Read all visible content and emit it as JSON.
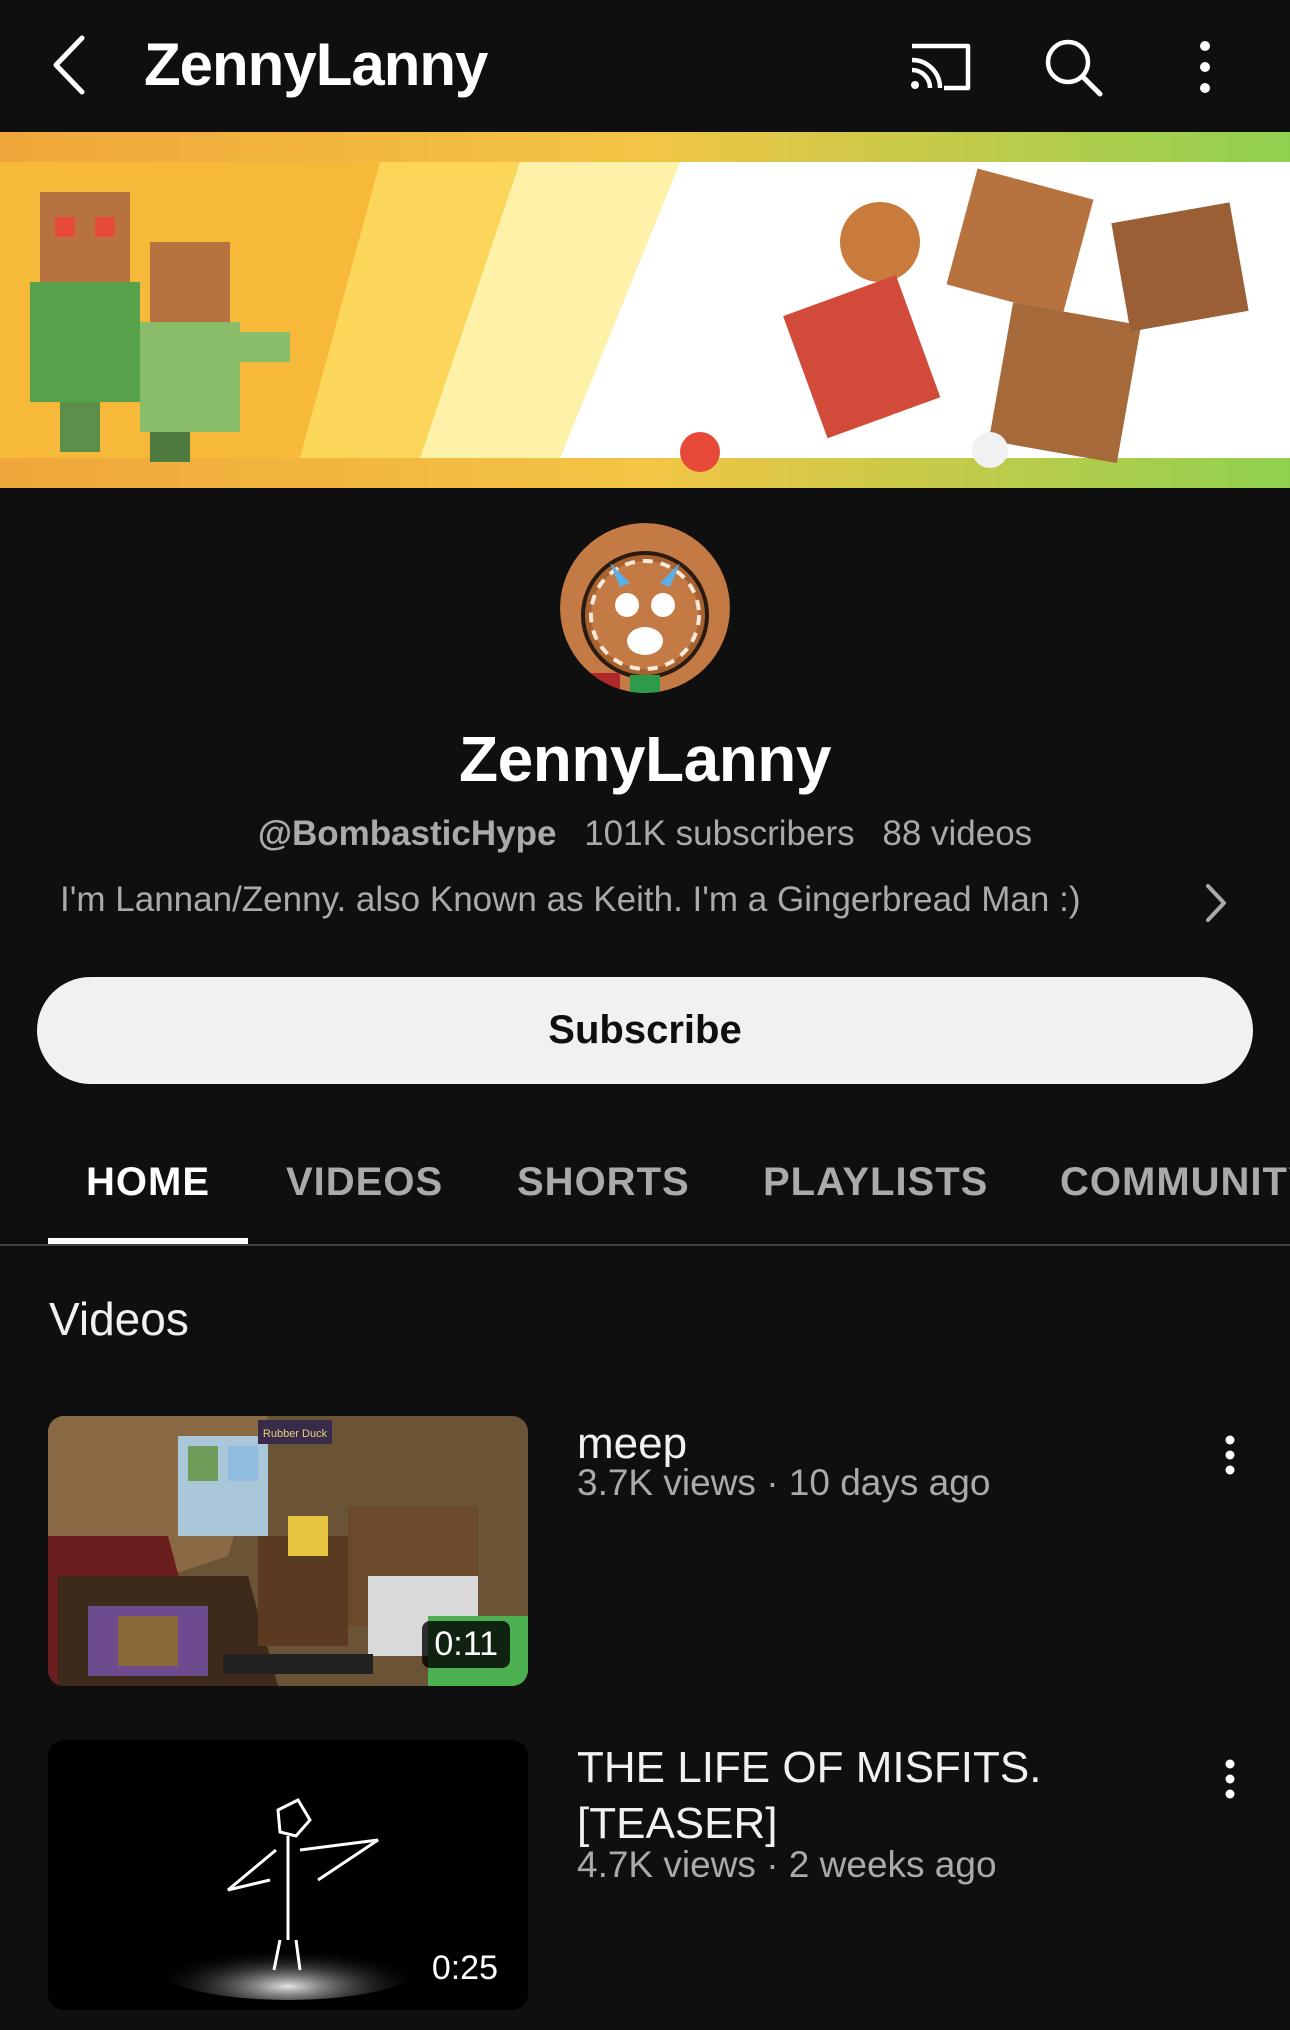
{
  "header": {
    "title": "ZennyLanny",
    "icons": [
      "back-icon",
      "cast-icon",
      "search-icon",
      "more-vert-icon"
    ]
  },
  "channel": {
    "name": "ZennyLanny",
    "handle": "@BombasticHype",
    "subscribers": "101K subscribers",
    "video_count": "88 videos",
    "description": "I'm Lannan/Zenny. also Known as Keith.  I'm a Gingerbread Man :)",
    "subscribe_label": "Subscribe"
  },
  "tabs": [
    {
      "label": "HOME",
      "active": true
    },
    {
      "label": "VIDEOS",
      "active": false
    },
    {
      "label": "SHORTS",
      "active": false
    },
    {
      "label": "PLAYLISTS",
      "active": false
    },
    {
      "label": "COMMUNITY",
      "active": false
    }
  ],
  "section": {
    "title": "Videos"
  },
  "videos": [
    {
      "title": "meep",
      "meta": "3.7K views · 10 days ago",
      "duration": "0:11",
      "thumb_overlay": "Rubber Duck"
    },
    {
      "title": "THE LIFE OF MISFITS. [TEASER]",
      "meta": "4.7K views · 2 weeks ago",
      "duration": "0:25"
    }
  ],
  "colors": {
    "background": "#0f0f0f",
    "text_primary": "#f1f1f1",
    "text_secondary": "#aaaaaa",
    "subscribe_bg": "#f1f1f1",
    "banner_green": "#8fd14f",
    "banner_yellow": "#f5c23a"
  }
}
